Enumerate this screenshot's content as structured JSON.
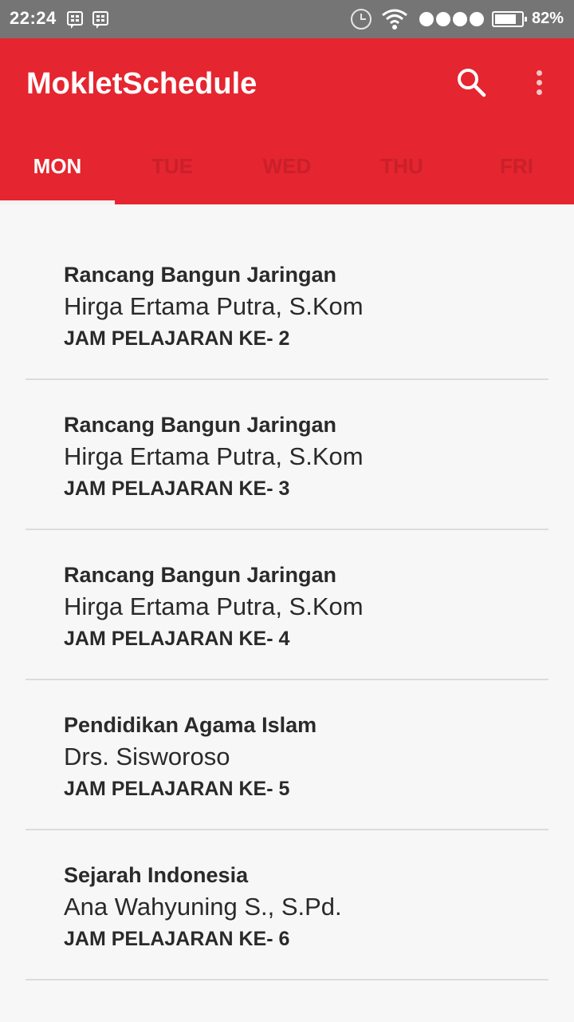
{
  "status_bar": {
    "time": "22:24",
    "battery": "82%",
    "icons": [
      "bbm-icon",
      "bbm-icon",
      "alarm-icon",
      "wifi-icon",
      "signal-icon",
      "battery-icon"
    ]
  },
  "app_bar": {
    "title": "MokletSchedule",
    "background": "#e5252f",
    "actions": [
      "search-icon",
      "more-vert-icon"
    ]
  },
  "tabs": [
    {
      "label": "MON",
      "active": true
    },
    {
      "label": "TUE",
      "active": false
    },
    {
      "label": "WED",
      "active": false
    },
    {
      "label": "THU",
      "active": false
    },
    {
      "label": "FRI",
      "active": false
    }
  ],
  "schedule": [
    {
      "subject": "Rancang Bangun Jaringan",
      "teacher": "Hirga Ertama Putra, S.Kom",
      "period": "JAM PELAJARAN KE- 2"
    },
    {
      "subject": "Rancang Bangun Jaringan",
      "teacher": "Hirga Ertama Putra, S.Kom",
      "period": "JAM PELAJARAN KE- 3"
    },
    {
      "subject": "Rancang Bangun Jaringan",
      "teacher": "Hirga Ertama Putra, S.Kom",
      "period": "JAM PELAJARAN KE- 4"
    },
    {
      "subject": "Pendidikan Agama Islam",
      "teacher": "Drs. Sisworoso",
      "period": "JAM PELAJARAN KE- 5"
    },
    {
      "subject": "Sejarah Indonesia",
      "teacher": "Ana Wahyuning S., S.Pd.",
      "period": "JAM PELAJARAN KE- 6"
    }
  ]
}
